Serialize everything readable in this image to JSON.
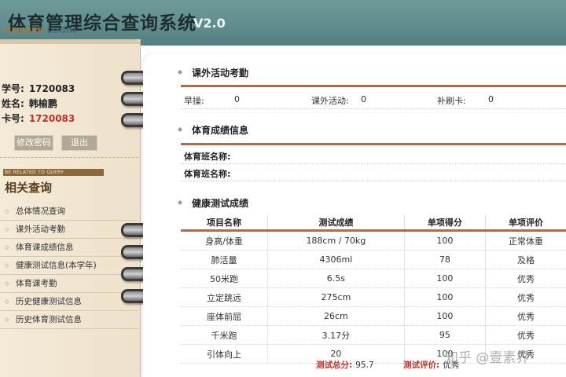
{
  "app": {
    "title": "体育管理综合查询系统",
    "version": "V2.0"
  },
  "member": {
    "heading_a": "MEMBER",
    "heading_b": "LOGIN",
    "student_no_label": "学号:",
    "student_no": "1720083",
    "name_label": "姓名:",
    "name": "韩榆鹏",
    "card_label": "卡号:",
    "card_no": "1720083",
    "change_pwd_label": "修改密码",
    "logout_label": "退出"
  },
  "related": {
    "bar_text": "BE RELATED TO QUERY",
    "title": "相关查询",
    "items": [
      "总体情况查询",
      "课外活动考勤",
      "体育课成绩信息",
      "健康测试信息(本学年)",
      "体育课考勤",
      "历史健康测试信息",
      "历史体育测试信息"
    ]
  },
  "attendance": {
    "title": "课外活动考勤",
    "morning_label": "早操:",
    "morning_value": "0",
    "activity_label": "课外活动:",
    "activity_value": "0",
    "makeup_label": "补刷卡:",
    "makeup_value": "0"
  },
  "pe_grades": {
    "title": "体育成绩信息",
    "class_label_1": "体育班名称:",
    "class_label_2": "体育班名称:"
  },
  "health_test": {
    "title": "健康测试成绩",
    "columns": [
      "项目名称",
      "测试成绩",
      "单项得分",
      "单项评价"
    ],
    "rows": [
      [
        "身高/体重",
        "188cm / 70kg",
        "100",
        "正常体重"
      ],
      [
        "肺活量",
        "4306ml",
        "78",
        "及格"
      ],
      [
        "50米跑",
        "6.5s",
        "100",
        "优秀"
      ],
      [
        "立定跳远",
        "275cm",
        "100",
        "优秀"
      ],
      [
        "座体前屈",
        "26cm",
        "100",
        "优秀"
      ],
      [
        "千米跑",
        "3.17分",
        "95",
        "优秀"
      ],
      [
        "引体向上",
        "20",
        "100",
        "优秀"
      ]
    ],
    "total_label": "测试总分:",
    "total_value": "95.7",
    "eval_label": "测试评价:",
    "eval_value": "优秀"
  },
  "watermark": "知乎 @壹素界",
  "colors": {
    "header_bg": "#5f8c8d",
    "accent_line": "#b06a4c",
    "card_red": "#c0302a",
    "page_bg": "#f4ead8"
  }
}
